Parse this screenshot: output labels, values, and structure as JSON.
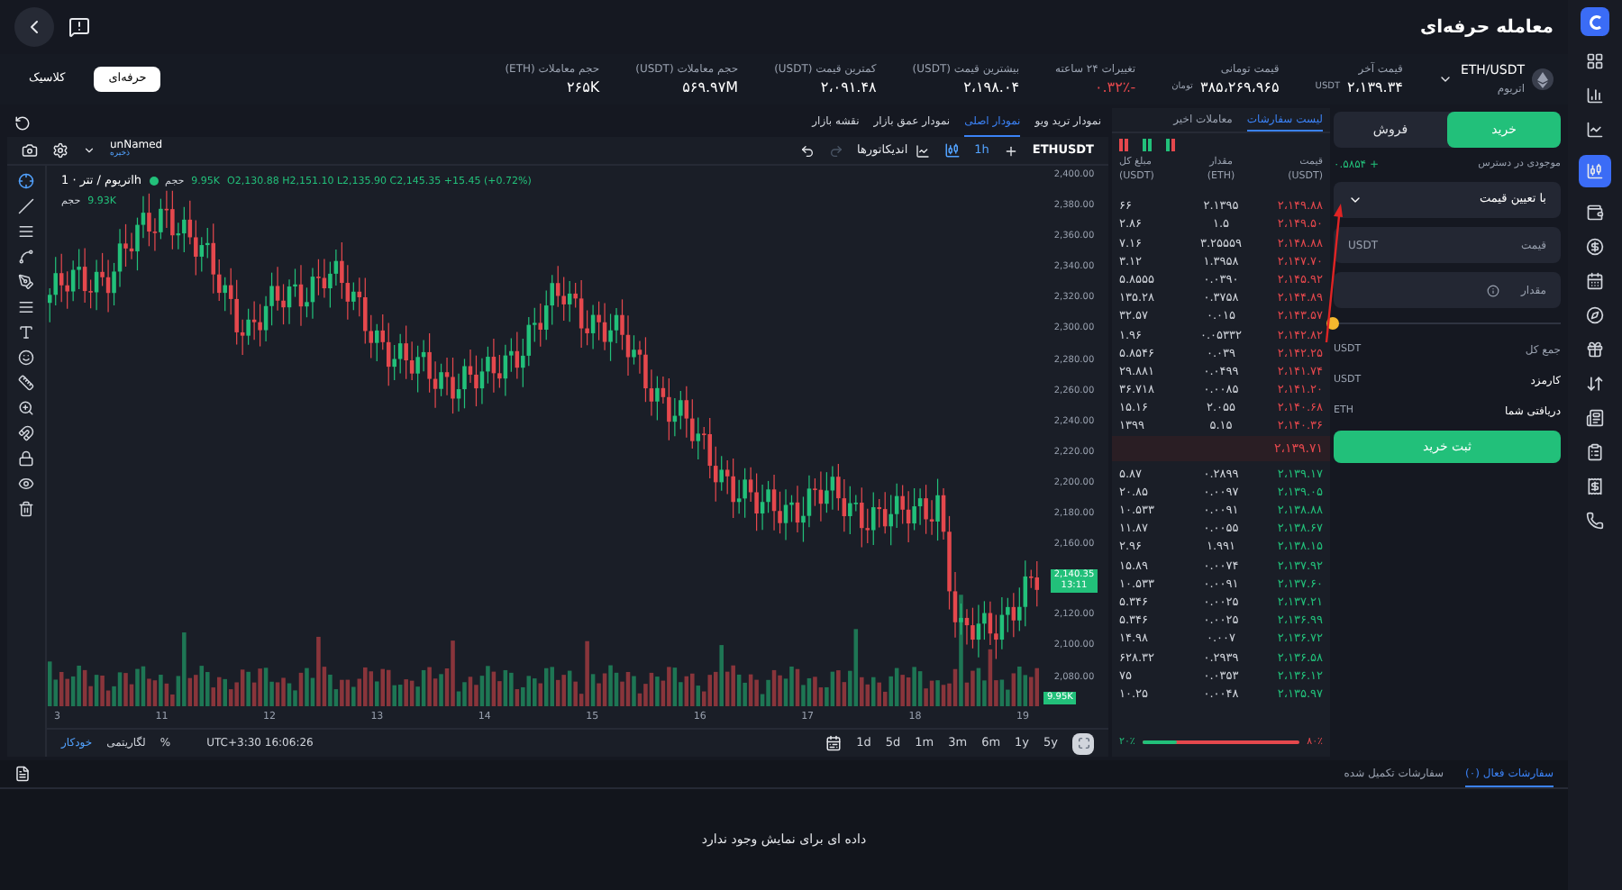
{
  "header": {
    "title": "معامله حرفه‌ای"
  },
  "mode_toggle": [
    {
      "label": "حرفه‌ای",
      "selected": true
    },
    {
      "label": "کلاسیک",
      "selected": false
    }
  ],
  "market": {
    "pair": "ETH/USDT",
    "name": "اتریوم"
  },
  "stats": [
    {
      "label": "قیمت آخر",
      "value": "۲،۱۳۹.۳۴",
      "unit": "USDT",
      "kind": "plain"
    },
    {
      "label": "قیمت تومانی",
      "value": "۳۸۵،۲۶۹،۹۶۵",
      "unit": "تومان",
      "kind": "plain"
    },
    {
      "label": "تغییرات ۲۴ ساعته",
      "value": "-۰.۳۲٪",
      "kind": "down"
    },
    {
      "label": "بیشترین قیمت (USDT)",
      "value": "۲،۱۹۸.۰۴",
      "kind": "plain"
    },
    {
      "label": "کمترین قیمت (USDT)",
      "value": "۲،۰۹۱.۴۸",
      "kind": "plain"
    },
    {
      "label": "حجم معاملات (USDT)",
      "value": "۵۶۹.۹۷M",
      "kind": "plain"
    },
    {
      "label": "حجم معاملات (ETH)",
      "value": "۲۶۵K",
      "kind": "plain"
    }
  ],
  "chart_tabs": [
    {
      "label": "نمودار ترید ویو",
      "selected": false
    },
    {
      "label": "نمودار اصلی",
      "selected": true
    },
    {
      "label": "نمودار عمق بازار",
      "selected": false
    },
    {
      "label": "نقشه بازار",
      "selected": false
    }
  ],
  "chart": {
    "symbol": "ETHUSDT",
    "interval": "1h",
    "indicators": "اندیکاتورها",
    "layout_name": "unNamed",
    "layout_status": "ذخیره",
    "legend_title": "اتریوم / تتر · 1h",
    "ohlc": "O2,130.88 H2,151.10 L2,135.90 C2,145.35 +15.45 (+0.72%)",
    "volume_label": "حجم",
    "volume_value": "9.95K",
    "legend_volume_label": "حجم",
    "legend_volume": "9.93K",
    "price_ticks": [
      "2,400.00",
      "2,380.00",
      "2,360.00",
      "2,340.00",
      "2,320.00",
      "2,300.00",
      "2,280.00",
      "2,260.00",
      "2,240.00",
      "2,220.00",
      "2,200.00",
      "2,180.00",
      "2,160.00",
      "2,120.00",
      "2,100.00",
      "2,080.00"
    ],
    "last_price": "2,140.35",
    "countdown": "13:11",
    "volume_tag": "9.95K",
    "date_ticks": [
      "19",
      "18",
      "17",
      "16",
      "15",
      "14",
      "13",
      "12",
      "11",
      "3"
    ],
    "ranges": [
      "5y",
      "1y",
      "6m",
      "3m",
      "1m",
      "5d",
      "1d"
    ],
    "clock": "UTC+3:30 16:06:26",
    "percent": "%",
    "log": "لگاریتمی",
    "auto": "خودکار"
  },
  "order_book": {
    "tabs": [
      {
        "label": "لیست سفارشات",
        "selected": true
      },
      {
        "label": "معاملات اخیر",
        "selected": false
      }
    ],
    "columns": [
      {
        "label": "قیمت",
        "unit": "(USDT)"
      },
      {
        "label": "مقدار",
        "unit": "(ETH)"
      },
      {
        "label": "مبلغ کل",
        "unit": "(USDT)"
      }
    ],
    "asks": [
      {
        "price": "۲،۱۴۹.۸۸",
        "amount": "۲.۱۳۹۵",
        "total": "۶۶"
      },
      {
        "price": "۲،۱۴۹.۵۰",
        "amount": "۱.۵",
        "total": "۲.۸۶"
      },
      {
        "price": "۲،۱۴۸.۸۸",
        "amount": "۳.۲۵۵۵۹",
        "total": "۷.۱۶"
      },
      {
        "price": "۲،۱۴۷.۷۰",
        "amount": "۱.۳۹۵۸",
        "total": "۳.۱۲"
      },
      {
        "price": "۲،۱۴۵.۹۲",
        "amount": "۰.۰۳۹۰",
        "total": "۵.۸۵۵۵"
      },
      {
        "price": "۲،۱۴۴.۸۹",
        "amount": "۰.۳۷۵۸",
        "total": "۱۳۵.۲۸"
      },
      {
        "price": "۲،۱۴۳.۵۷",
        "amount": "۰.۰۱۵",
        "total": "۳۲.۵۷"
      },
      {
        "price": "۲،۱۴۲.۸۲",
        "amount": "۰.۰۵۳۳۲",
        "total": "۱.۹۶"
      },
      {
        "price": "۲،۱۴۲.۲۵",
        "amount": "۰.۰۳۹",
        "total": "۵.۸۵۴۶"
      },
      {
        "price": "۲،۱۴۱.۷۴",
        "amount": "۰.۰۴۹۹",
        "total": "۲۹.۸۸۱"
      },
      {
        "price": "۲،۱۴۱.۲۰",
        "amount": "۰.۰۰۸۵",
        "total": "۳۶.۷۱۸"
      },
      {
        "price": "۲،۱۴۰.۶۸",
        "amount": "۲.۰۵۵",
        "total": "۱۵.۱۶"
      },
      {
        "price": "۲،۱۴۰.۳۶",
        "amount": "۵.۱۵",
        "total": "۱۳۹۹"
      }
    ],
    "mid_price": "۲،۱۳۹.۷۱",
    "bids": [
      {
        "price": "۲،۱۳۹.۱۷",
        "amount": "۰.۲۸۹۹",
        "total": "۵.۸۷"
      },
      {
        "price": "۲،۱۳۹.۰۵",
        "amount": "۰.۰۰۹۷",
        "total": "۲۰.۸۵"
      },
      {
        "price": "۲،۱۳۸.۸۸",
        "amount": "۰.۰۰۹۱",
        "total": "۱۰.۵۳۳"
      },
      {
        "price": "۲،۱۳۸.۶۷",
        "amount": "۰.۰۰۵۵",
        "total": "۱۱.۸۷"
      },
      {
        "price": "۲،۱۳۸.۱۵",
        "amount": "۱.۹۹۱",
        "total": "۲.۹۶"
      },
      {
        "price": "۲،۱۳۷.۹۲",
        "amount": "۰.۰۰۷۴",
        "total": "۱۵.۸۹"
      },
      {
        "price": "۲،۱۳۷.۶۰",
        "amount": "۰.۰۰۹۱",
        "total": "۱۰.۵۳۳"
      },
      {
        "price": "۲،۱۳۷.۲۱",
        "amount": "۰.۰۰۲۵",
        "total": "۵.۳۴۶"
      },
      {
        "price": "۲،۱۳۶.۹۹",
        "amount": "۰.۰۰۲۵",
        "total": "۵.۳۴۶"
      },
      {
        "price": "۲،۱۳۶.۷۲",
        "amount": "۰.۰۰۷",
        "total": "۱۴.۹۸"
      },
      {
        "price": "۲،۱۳۶.۵۸",
        "amount": "۰.۲۹۳۹",
        "total": "۶۲۸.۳۲"
      },
      {
        "price": "۲،۱۳۶.۱۲",
        "amount": "۰.۰۳۵۳",
        "total": "۷۵"
      },
      {
        "price": "۲،۱۳۵.۹۷",
        "amount": "۰.۰۰۴۸",
        "total": "۱۰.۲۵"
      }
    ],
    "buy_label": "۲۰٪",
    "sell_label": "۸۰٪",
    "level": 0.22
  },
  "order_form": {
    "tabs": [
      {
        "label": "خرید",
        "selected": true
      },
      {
        "label": "فروش",
        "selected": false
      }
    ],
    "balance_label": "موجودی در دسترس",
    "balance_value": "+ ۰.۵۸۵۴",
    "order_type": "با تعیین قیمت",
    "price_label": "قیمت",
    "price_unit": "USDT",
    "amount_label": "مقدار",
    "slider": {
      "level": 0
    },
    "rows": [
      {
        "label": "جمع کل",
        "unit": "USDT"
      },
      {
        "label": "کارمزد",
        "unit": "USDT"
      },
      {
        "label": "دریافتی شما",
        "unit": "ETH"
      }
    ],
    "submit": "ثبت خرید"
  },
  "orders": {
    "tabs": [
      {
        "label": "سفارشات فعال (۰)",
        "selected": true
      },
      {
        "label": "سفارشات تکمیل شده",
        "selected": false
      }
    ],
    "empty": "داده ای برای نمایش وجود ندارد"
  }
}
